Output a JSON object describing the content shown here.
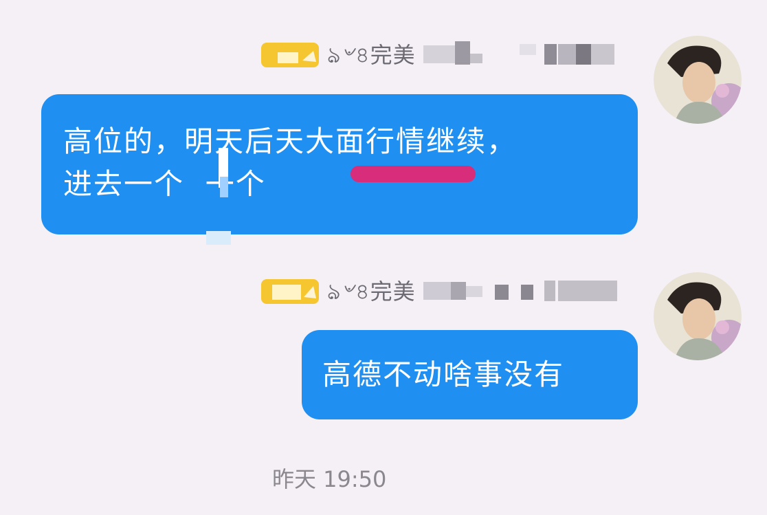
{
  "colors": {
    "background": "#f5f0f6",
    "bubble": "#1f8ff1",
    "bubble_text": "#ffffff",
    "sender_text": "#6c6a72",
    "highlight": "#d72d7a",
    "badge": "#f6c631",
    "timestamp_text": "#8a878f"
  },
  "messages": [
    {
      "sender_prefix": "ঌ৺৪完美",
      "text": "高位的，明天后天大面行情继续，\n进去一个  一个",
      "avatar_icon": "user-avatar-photo",
      "badge_icon": "level-badge-icon"
    },
    {
      "sender_prefix": "ঌ৺৪完美",
      "text": "高德不动啥事没有",
      "avatar_icon": "user-avatar-photo",
      "badge_icon": "level-badge-icon"
    }
  ],
  "timestamp": "昨天 19:50"
}
